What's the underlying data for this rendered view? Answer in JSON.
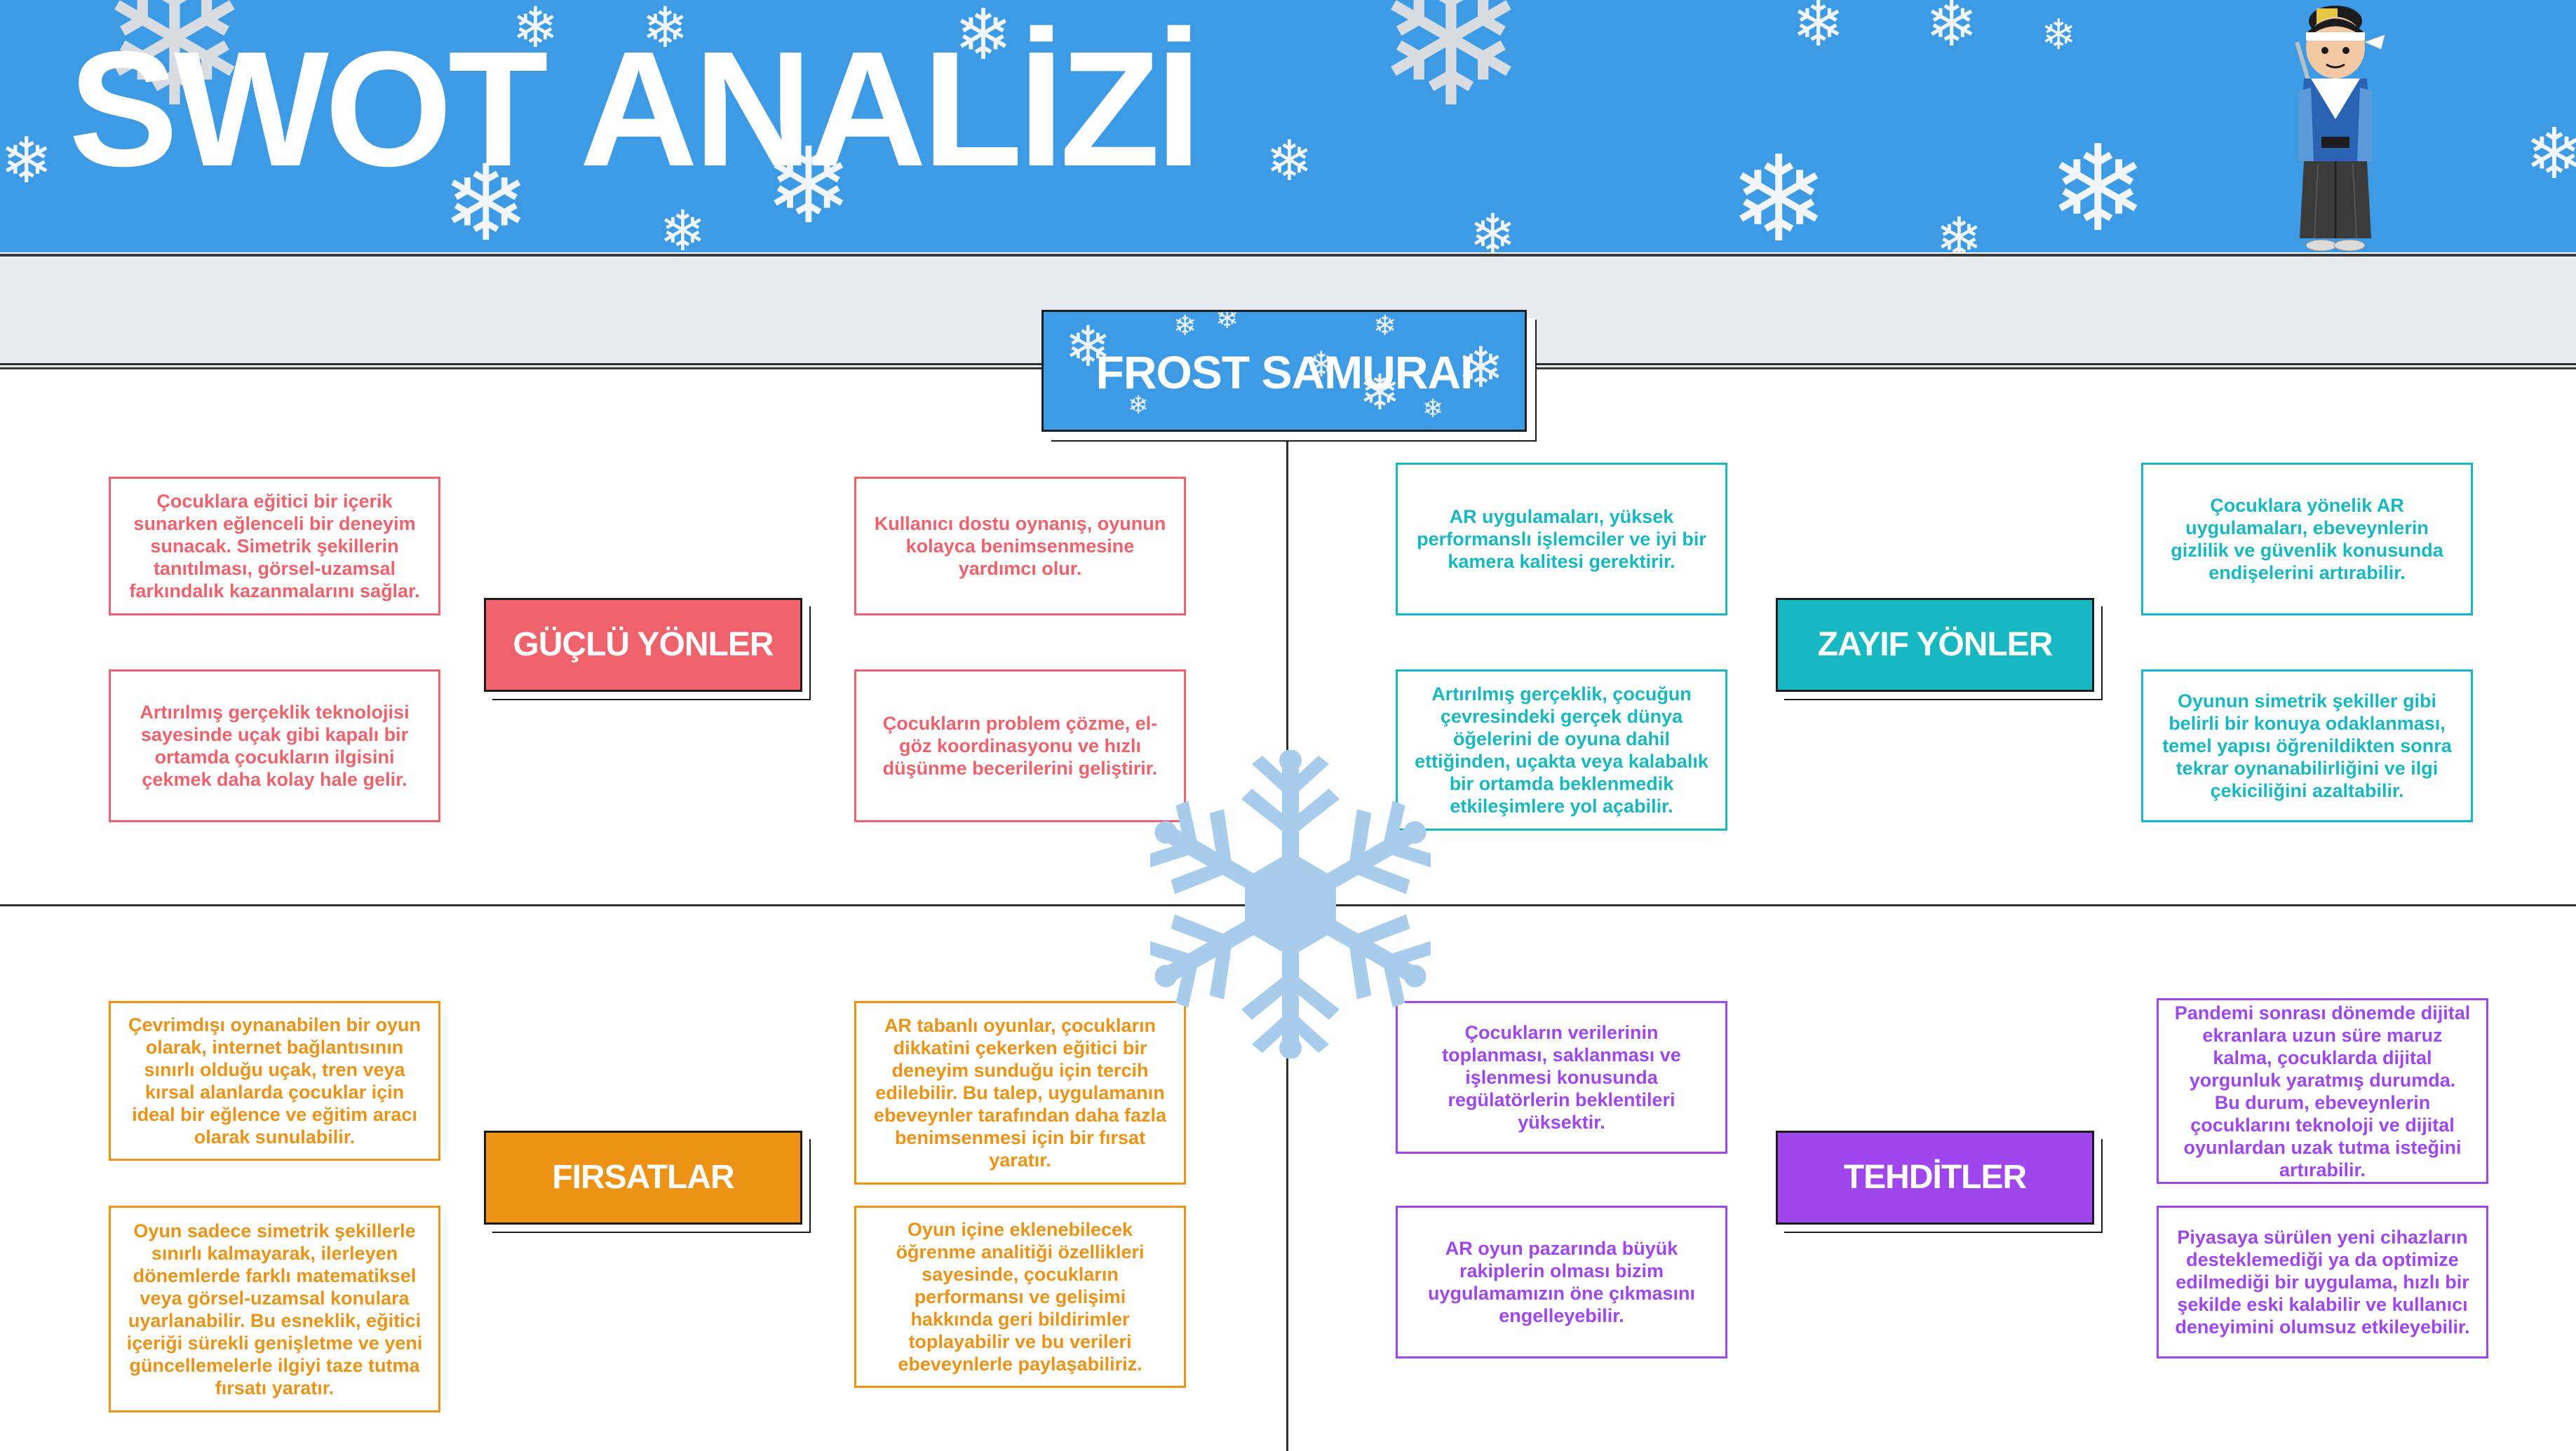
{
  "header": {
    "title": "SWOT ANALİZİ"
  },
  "center": {
    "title": "FROST SAMURAI"
  },
  "quadrants": {
    "strengths": {
      "label": "GÜÇLÜ YÖNLER",
      "color": "#f0626b",
      "items": [
        "Çocuklara eğitici bir içerik sunarken eğlenceli bir deneyim sunacak. Simetrik şekillerin tanıtılması, görsel-uzamsal farkındalık kazanmalarını sağlar.",
        "Kullanıcı dostu oynanış, oyunun kolayca benimsenmesine yardımcı olur.",
        "Artırılmış gerçeklik teknolojisi sayesinde uçak gibi kapalı bir ortamda çocukların ilgisini çekmek daha kolay hale gelir.",
        "Çocukların problem çözme, el-göz koordinasyonu ve hızlı düşünme becerilerini geliştirir."
      ]
    },
    "weaknesses": {
      "label": "ZAYIF YÖNLER",
      "color": "#16b8c2",
      "items": [
        "AR uygulamaları, yüksek performanslı işlemciler ve iyi bir kamera kalitesi gerektirir.",
        "Çocuklara yönelik AR uygulamaları, ebeveynlerin gizlilik ve güvenlik konusunda endişelerini artırabilir.",
        "Artırılmış gerçeklik, çocuğun çevresindeki gerçek dünya öğelerini de oyuna dahil ettiğinden, uçakta veya kalabalık bir ortamda beklenmedik etkileşimlere yol açabilir.",
        "Oyunun simetrik şekiller gibi belirli bir konuya odaklanması, temel yapısı öğrenildikten sonra tekrar oynanabilirliğini ve ilgi çekiciliğini azaltabilir."
      ]
    },
    "opportunities": {
      "label": "FIRSATLAR",
      "color": "#ec9214",
      "items": [
        "Çevrimdışı oynanabilen bir oyun olarak, internet bağlantısının sınırlı olduğu uçak, tren veya kırsal alanlarda çocuklar için ideal bir eğlence ve eğitim aracı olarak sunulabilir.",
        "AR tabanlı oyunlar, çocukların dikkatini çekerken eğitici bir deneyim sunduğu için tercih edilebilir. Bu talep, uygulamanın ebeveynler tarafından daha fazla benimsenmesi için bir fırsat yaratır.",
        "Oyun sadece simetrik şekillerle sınırlı kalmayarak, ilerleyen dönemlerde farklı matematiksel veya görsel-uzamsal konulara uyarlanabilir. Bu esneklik, eğitici içeriği sürekli genişletme ve yeni güncellemelerle ilgiyi taze tutma fırsatı yaratır.",
        "Oyun içine eklenebilecek öğrenme analitiği özellikleri sayesinde, çocukların performansı ve gelişimi hakkında geri bildirimler toplayabilir ve bu verileri ebeveynlerle paylaşabiliriz."
      ]
    },
    "threats": {
      "label": "TEHDİTLER",
      "color": "#a046ee",
      "items": [
        "Çocukların verilerinin toplanması, saklanması ve işlenmesi konusunda regülatörlerin beklentileri yüksektir.",
        "Pandemi sonrası dönemde dijital ekranlara uzun süre maruz kalma, çocuklarda dijital yorgunluk yaratmış durumda. Bu durum, ebeveynlerin çocuklarını teknoloji ve dijital oyunlardan uzak tutma isteğini artırabilir.",
        "AR oyun pazarında büyük rakiplerin olması bizim uygulamamızın öne çıkmasını engelleyebilir.",
        "Piyasaya sürülen yeni cihazların desteklemediği ya da optimize edilmediği bir uygulama, hızlı bir şekilde eski kalabilir ve kullanıcı deneyimini olumsuz etkileyebilir."
      ]
    }
  },
  "decor": {
    "banner_color": "#3d9be6",
    "snowflake_color": "#a8cdec",
    "icons": [
      "snowflake-icon",
      "samurai-illustration"
    ]
  }
}
